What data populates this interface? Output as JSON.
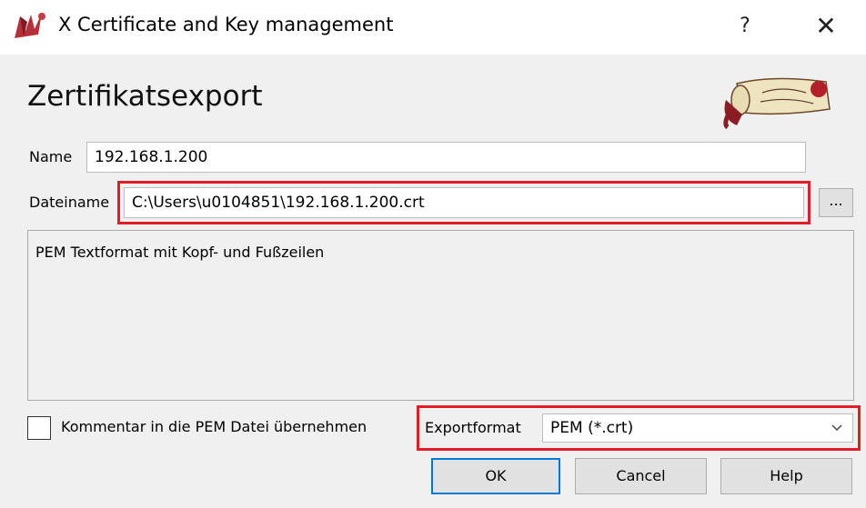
{
  "window": {
    "title": "X Certificate and Key management",
    "help_glyph": "?",
    "close_glyph": "✕"
  },
  "dialog": {
    "heading": "Zertifikatsexport",
    "name_label": "Name",
    "name_value": "192.168.1.200",
    "filename_label": "Dateiname",
    "filename_value": "C:\\Users\\u0104851\\192.168.1.200.crt",
    "browse_label": "...",
    "description": "PEM Textformat mit Kopf- und Fußzeilen",
    "comment_checkbox_label": "Kommentar in die PEM Datei übernehmen",
    "comment_checked": false,
    "exportformat_label": "Exportformat",
    "exportformat_value": "PEM (*.crt)",
    "ok_label": "OK",
    "cancel_label": "Cancel",
    "help_label": "Help"
  },
  "colors": {
    "highlight": "#e11d2a",
    "default_button_border": "#0078d7",
    "background": "#f0f0f0"
  },
  "icons": [
    "app-logo-icon",
    "help-icon",
    "close-icon",
    "chevron-down-icon",
    "xca-logo"
  ]
}
